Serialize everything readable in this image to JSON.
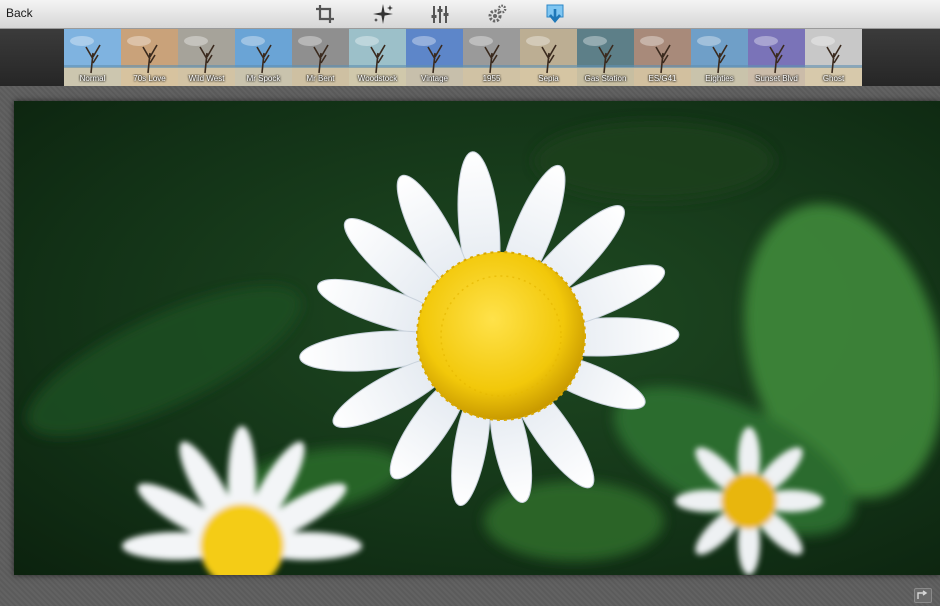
{
  "toolbar": {
    "back_label": "Back",
    "tools": [
      "crop-icon",
      "effects-sparkle-icon",
      "adjust-sliders-icon",
      "settings-gears-icon",
      "save-download-icon"
    ]
  },
  "filters": [
    {
      "label": "Normal",
      "tint": "#7fb3e0"
    },
    {
      "label": "70s Love",
      "tint": "#c9a27a"
    },
    {
      "label": "Wild West",
      "tint": "#a6a39a"
    },
    {
      "label": "Mr Spock",
      "tint": "#6aa4d6"
    },
    {
      "label": "Mr Bent",
      "tint": "#8f8f8f"
    },
    {
      "label": "Woodstock",
      "tint": "#9cc0c9"
    },
    {
      "label": "Vintage",
      "tint": "#5d86c9"
    },
    {
      "label": "1955",
      "tint": "#9a9a9a"
    },
    {
      "label": "Sepia",
      "tint": "#bcae93"
    },
    {
      "label": "Gas Station",
      "tint": "#5d7f88"
    },
    {
      "label": "ES/G41",
      "tint": "#a88a7a"
    },
    {
      "label": "Eighties",
      "tint": "#6f9fc8"
    },
    {
      "label": "Sunset Blvd",
      "tint": "#7a73b8"
    },
    {
      "label": "Ghost",
      "tint": "#c8c8c8"
    }
  ],
  "colors": {
    "toolbar_bg": "#e4e4e4",
    "strip_bg": "#2f2f2f",
    "accent_blue": "#3aa0e0",
    "daisy_center": "#f2c80a",
    "leaf_green": "#2e6b2c"
  }
}
